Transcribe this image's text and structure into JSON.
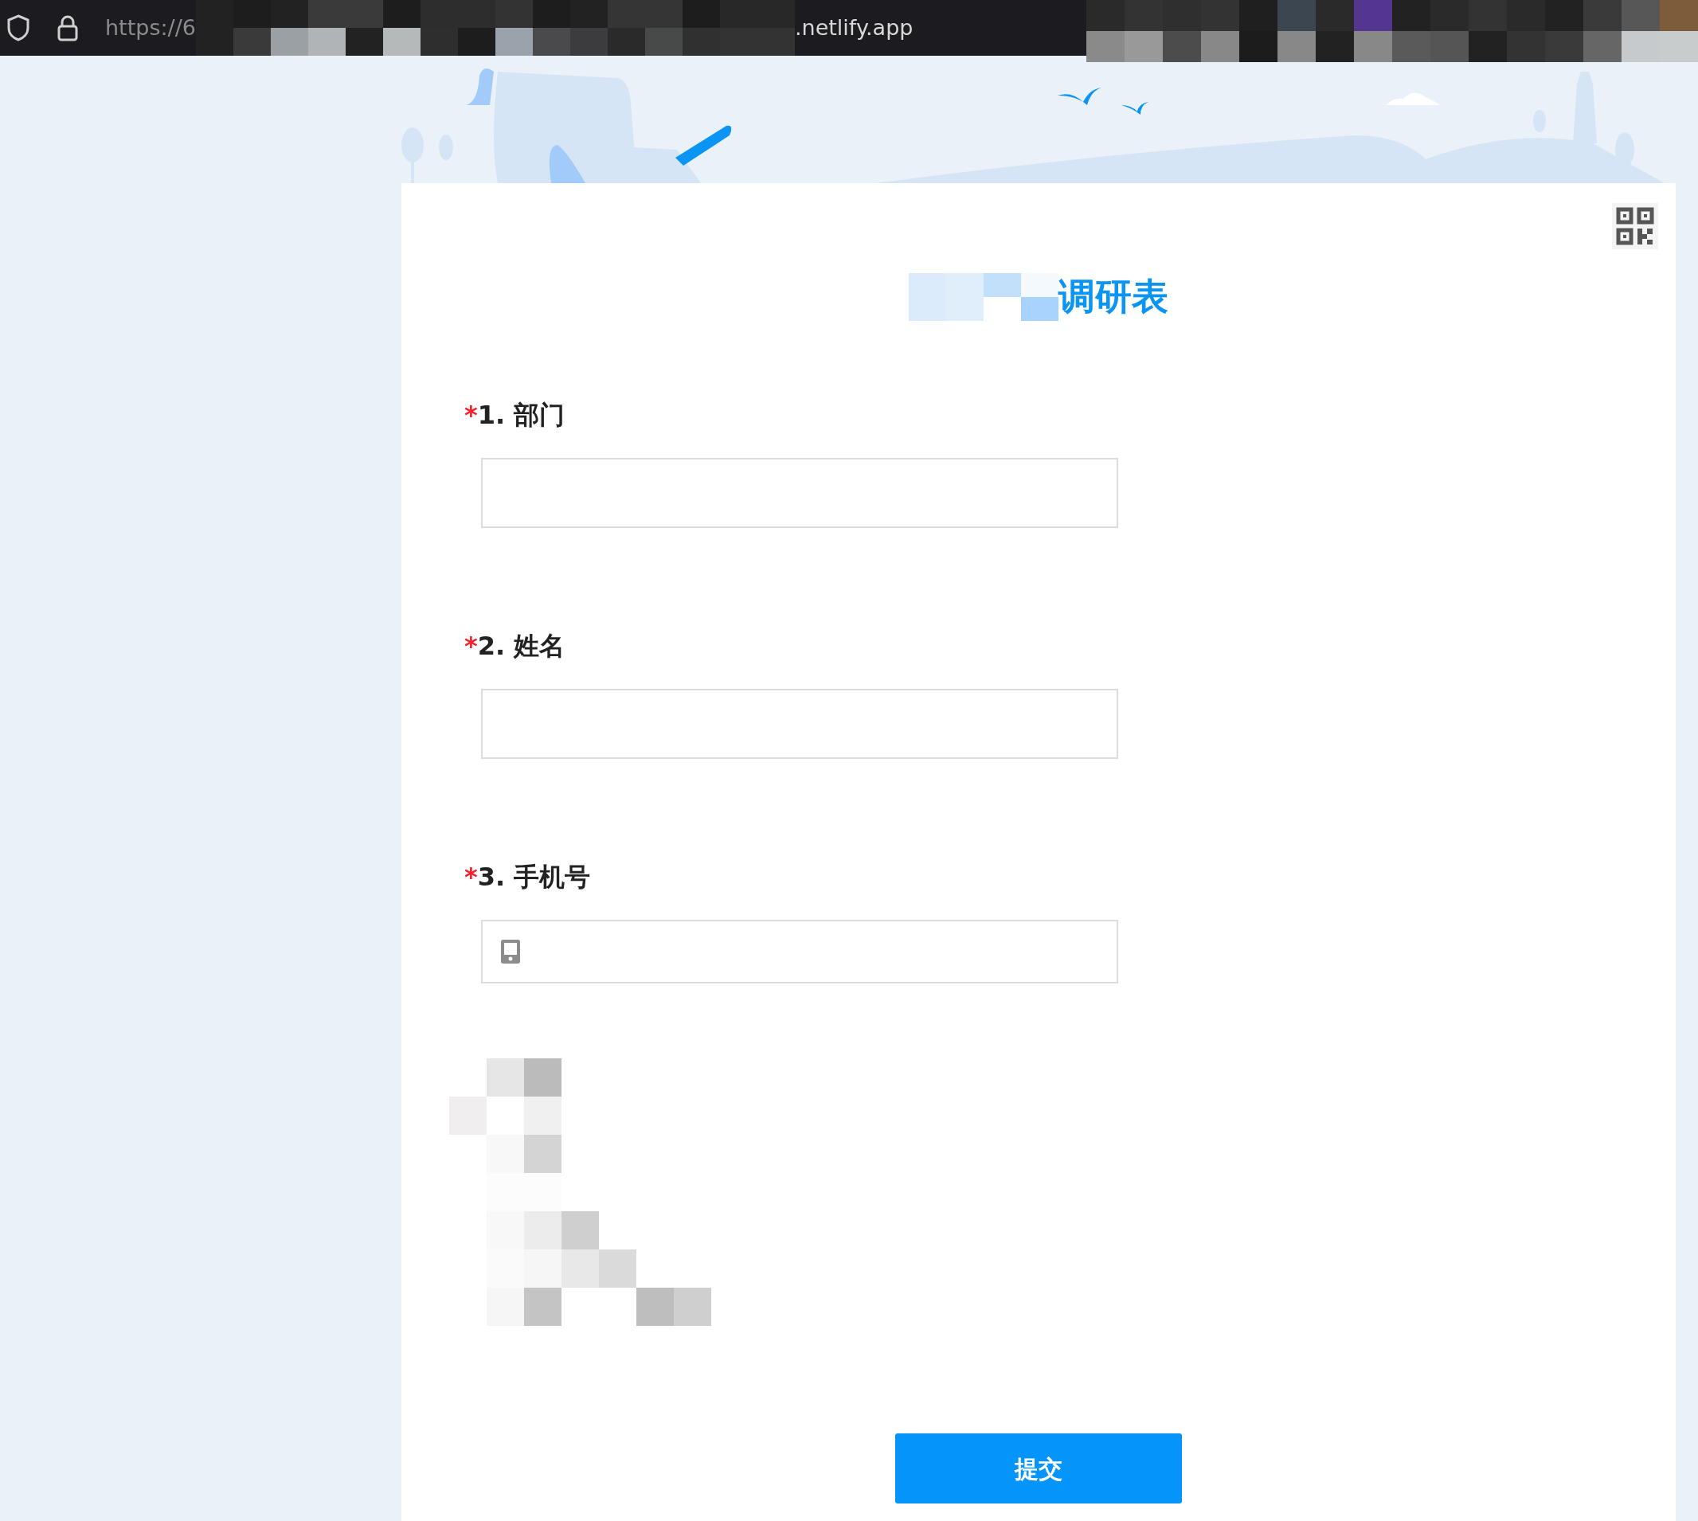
{
  "browser": {
    "url_start": "https://6",
    "url_end": ".netlify.app"
  },
  "form": {
    "title": "调研表",
    "questions": [
      {
        "required_mark": "*",
        "label": "1. 部门",
        "kind": "text"
      },
      {
        "required_mark": "*",
        "label": "2. 姓名",
        "kind": "text"
      },
      {
        "required_mark": "*",
        "label": "3. 手机号",
        "kind": "phone"
      }
    ],
    "submit": "提交"
  }
}
